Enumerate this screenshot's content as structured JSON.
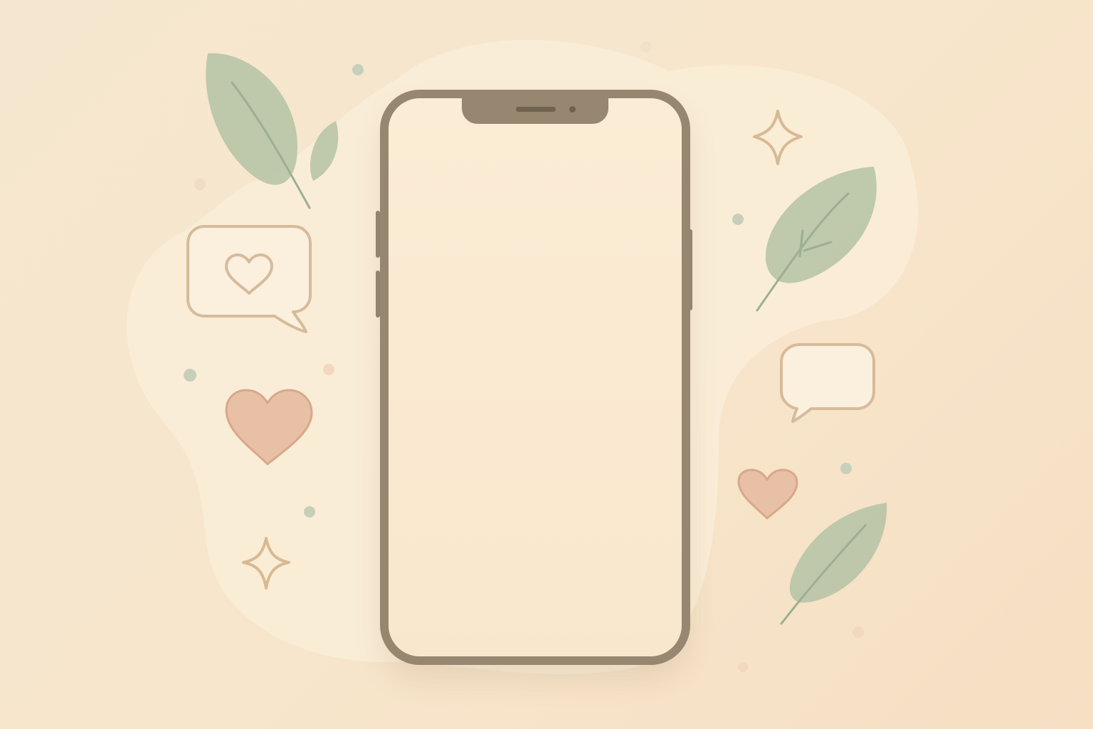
{
  "colors": {
    "background": "#f6e4ca",
    "phone_frame": "#978670",
    "phone_screen": "#fae9d0",
    "leaf": "#b8c3a4",
    "heart": "#e6b99a",
    "outline": "#d8b994",
    "sparkle": "#d8b994",
    "dot": "#c9d0bb"
  },
  "icons": [
    "leaf-icon",
    "chat-heart-icon",
    "heart-icon",
    "sparkle-icon",
    "chat-bubble-icon"
  ]
}
